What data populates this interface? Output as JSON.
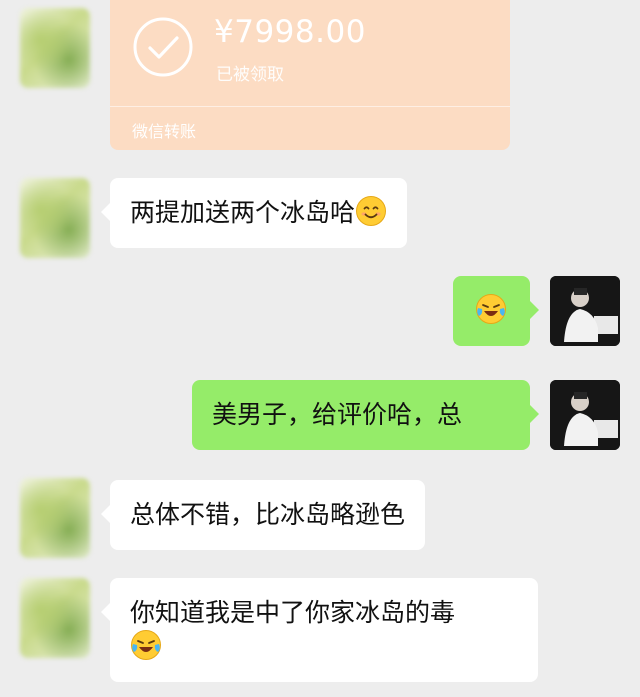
{
  "transfer": {
    "amount": "¥7998.00",
    "status": "已被领取",
    "footer": "微信转账",
    "icon": "check-circle-icon"
  },
  "messages": [
    {
      "direction": "incoming",
      "text": "两提加送两个冰岛哈",
      "emoji": "smiling-face-icon"
    },
    {
      "direction": "outgoing",
      "text": "",
      "emoji": "face-with-tears-of-joy-icon"
    },
    {
      "direction": "outgoing",
      "text": "美男子，给评价哈，总"
    },
    {
      "direction": "incoming",
      "text": "总体不错，比冰岛略逊色"
    },
    {
      "direction": "incoming",
      "text": "你知道我是中了你家冰岛的毒",
      "emoji": "face-with-tears-of-joy-icon"
    }
  ],
  "colors": {
    "background": "#ededed",
    "incoming_bubble": "#ffffff",
    "outgoing_bubble": "#95ec69",
    "transfer_card": "#fcdcc3"
  }
}
